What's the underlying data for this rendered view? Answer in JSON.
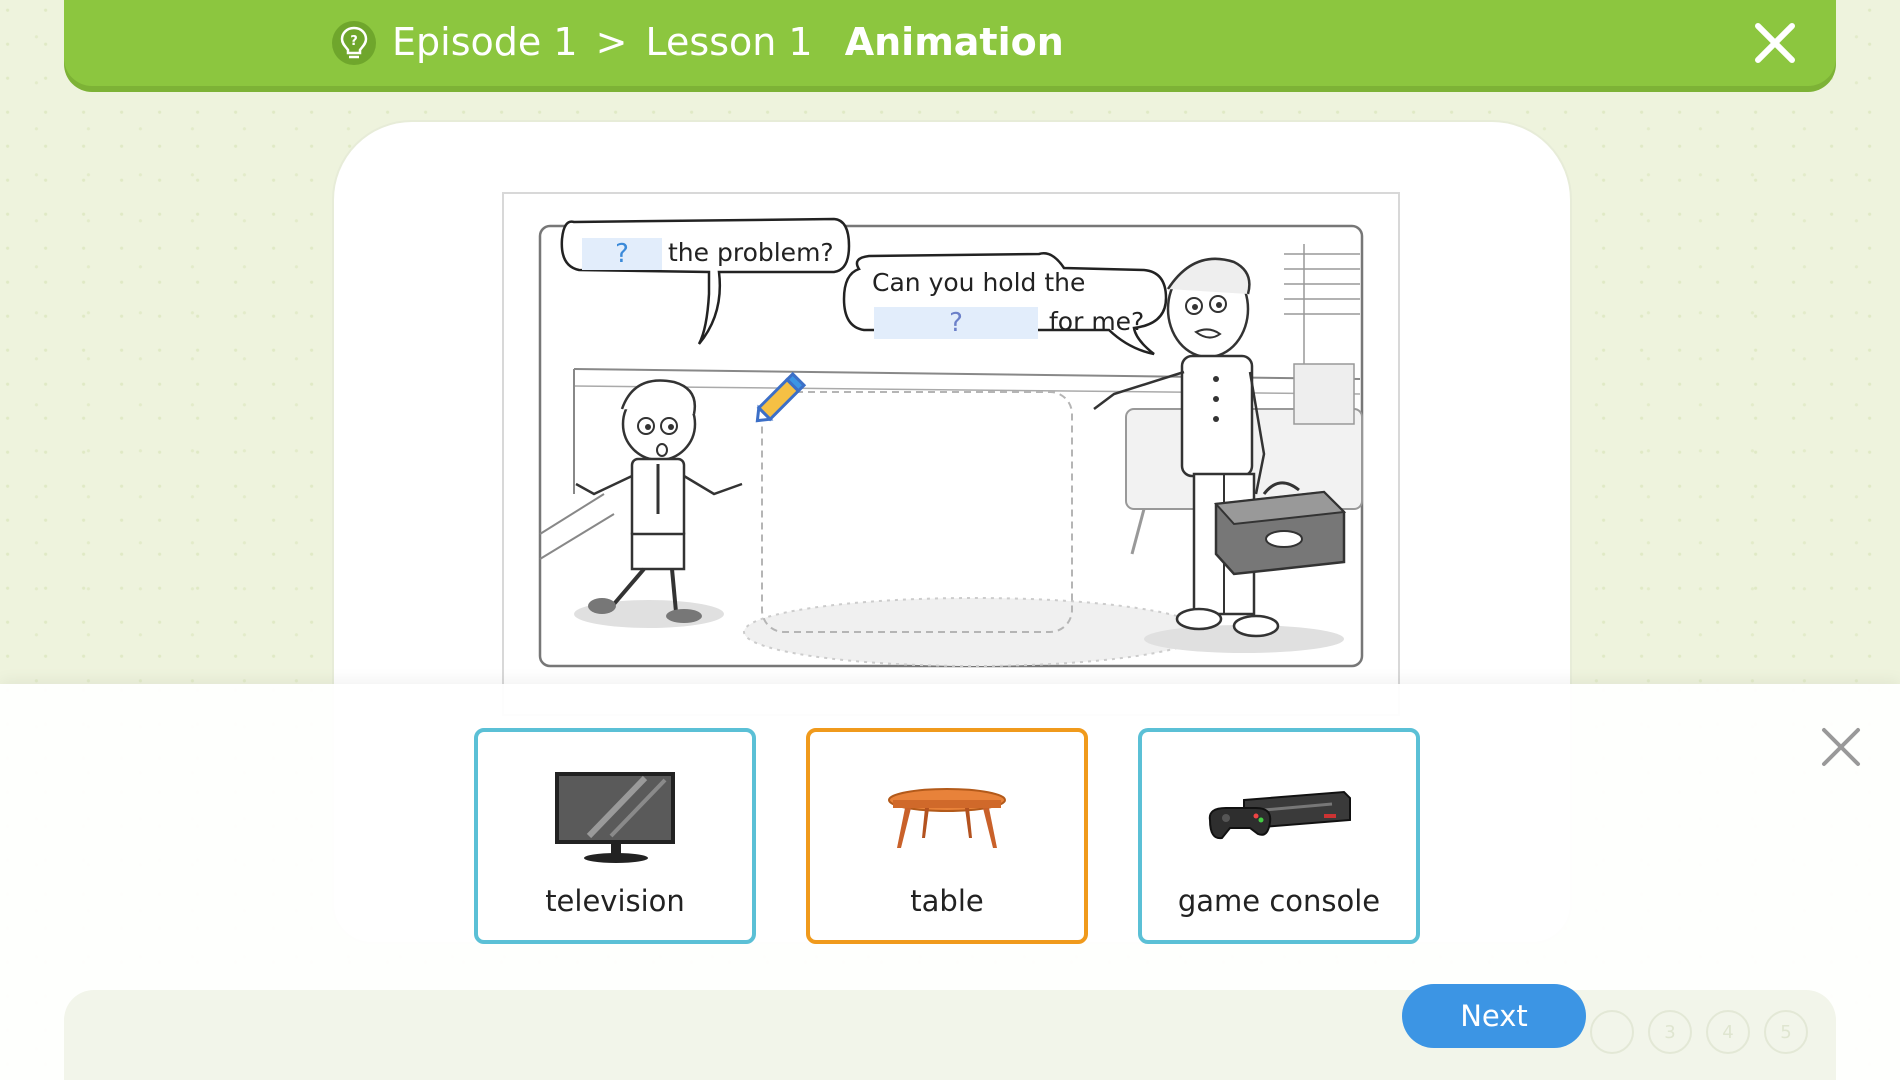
{
  "header": {
    "episode": "Episode 1",
    "separator": ">",
    "lesson": "Lesson 1",
    "section": "Animation",
    "hint_icon": "lightbulb-question-icon",
    "close_icon": "close-icon"
  },
  "scene": {
    "speech_bubble_1": {
      "blank": "?",
      "text": "the problem?"
    },
    "speech_bubble_2": {
      "line1": "Can you hold the",
      "blank": "?",
      "line2": "for me?"
    },
    "drop_zone_icon": "pencil-icon"
  },
  "options": [
    {
      "label": "television",
      "icon": "television-icon",
      "selected": false
    },
    {
      "label": "table",
      "icon": "table-icon",
      "selected": true
    },
    {
      "label": "game console",
      "icon": "game-console-icon",
      "selected": false
    }
  ],
  "options_close_icon": "close-icon",
  "footer": {
    "next_label": "Next",
    "page_dots": [
      "",
      "3",
      "4",
      "5"
    ]
  },
  "colors": {
    "header_green": "#8cc63f",
    "option_border": "#5bc0d6",
    "selected_border": "#f09a1c",
    "next_button": "#3c95e4"
  }
}
